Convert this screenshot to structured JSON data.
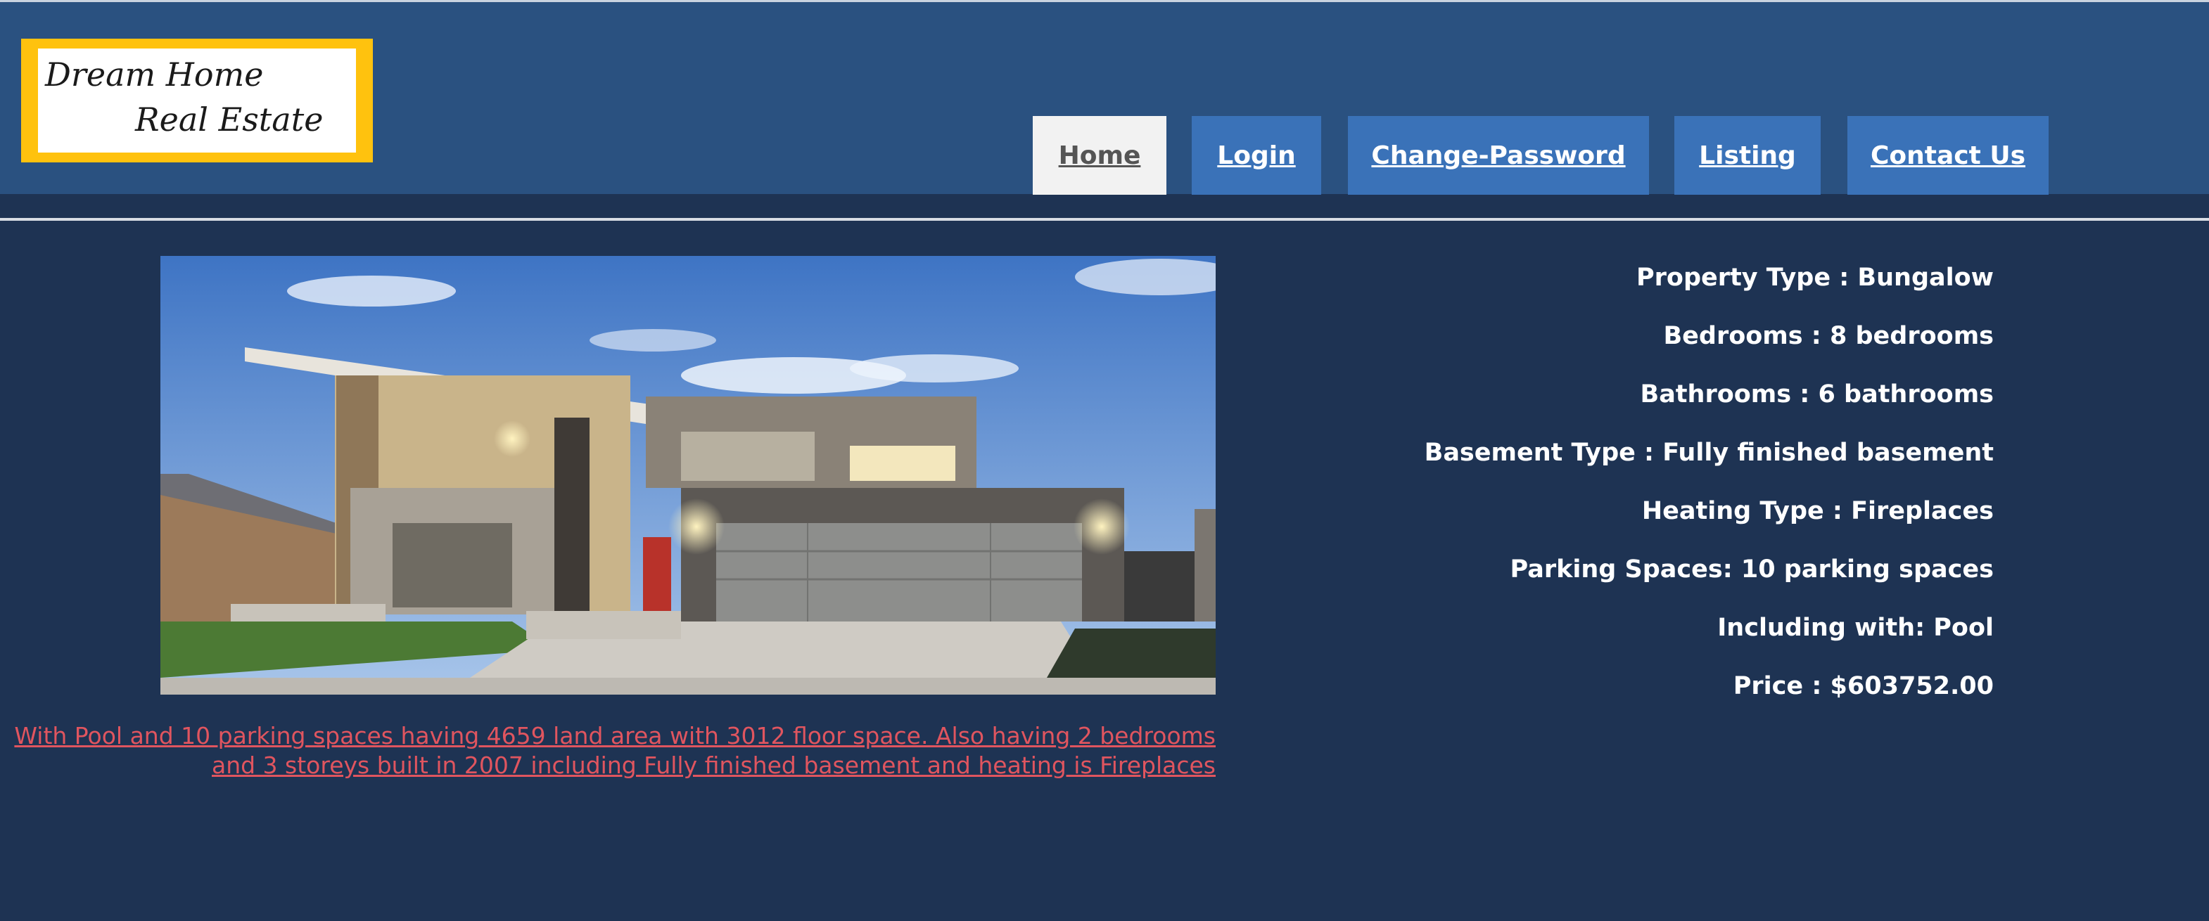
{
  "logo": {
    "line1": "Dream Home",
    "line2": "Real Estate"
  },
  "nav": {
    "home": "Home",
    "login": "Login",
    "change_password": "Change-Password",
    "listing": "Listing",
    "contact": "Contact Us"
  },
  "property": {
    "description": "With Pool and 10 parking spaces having 4659 land area with 3012 floor space. Also having 2 bedrooms and 3 storeys built in 2007 including Fully finished basement and heating is Fireplaces",
    "details": [
      "Property Type : Bungalow",
      "Bedrooms : 8 bedrooms",
      "Bathrooms : 6 bathrooms",
      "Basement Type : Fully finished basement",
      "Heating Type : Fireplaces",
      "Parking Spaces: 10 parking spaces",
      "Including with: Pool",
      "Price : $603752.00"
    ]
  },
  "colors": {
    "page_bg": "#1e3353",
    "header_bg": "#2a5180",
    "nav_bg": "#3a72b8",
    "nav_active_bg": "#f2f2f2",
    "logo_border": "#ffc20e",
    "link": "#e0555f"
  }
}
